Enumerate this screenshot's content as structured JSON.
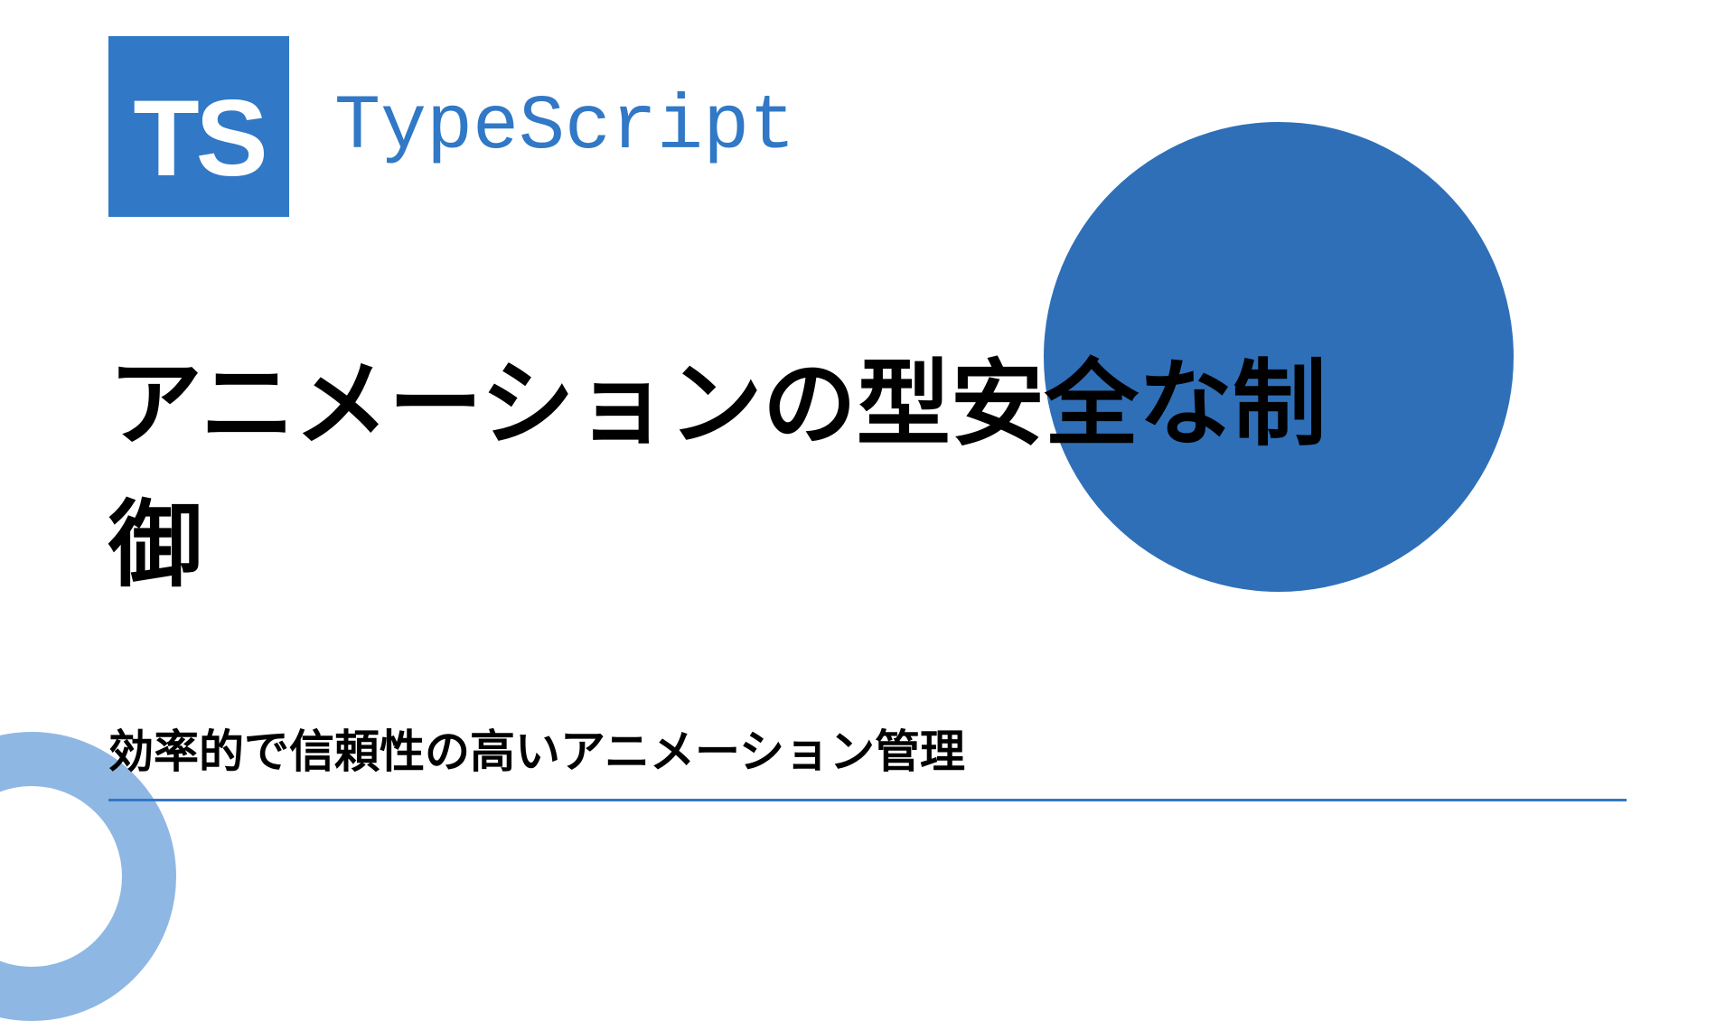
{
  "logo": {
    "text": "TS"
  },
  "brand": "TypeScript",
  "title": "アニメーションの型安全な制御",
  "subtitle": "効率的で信頼性の高いアニメーション管理"
}
